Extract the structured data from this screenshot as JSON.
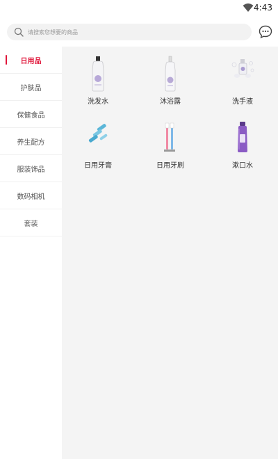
{
  "status_bar": {
    "time": "4:43"
  },
  "search": {
    "placeholder": "请搜索您想要的商品"
  },
  "sidebar": {
    "items": [
      {
        "label": "日用品",
        "active": true
      },
      {
        "label": "护肤品",
        "active": false
      },
      {
        "label": "保健食品",
        "active": false
      },
      {
        "label": "养生配方",
        "active": false
      },
      {
        "label": "服装饰品",
        "active": false
      },
      {
        "label": "数码相机",
        "active": false
      },
      {
        "label": "套装",
        "active": false
      }
    ]
  },
  "products": [
    {
      "label": "洗发水",
      "icon": "shampoo-bottle-icon"
    },
    {
      "label": "沐浴露",
      "icon": "body-wash-bottle-icon"
    },
    {
      "label": "洗手液",
      "icon": "hand-soap-icon"
    },
    {
      "label": "日用牙膏",
      "icon": "toothpaste-icon"
    },
    {
      "label": "日用牙刷",
      "icon": "toothbrush-icon"
    },
    {
      "label": "漱口水",
      "icon": "mouthwash-icon"
    }
  ],
  "colors": {
    "accent": "#e0163a",
    "content_bg": "#f4f4f4",
    "search_bg": "#f2f2f2"
  }
}
